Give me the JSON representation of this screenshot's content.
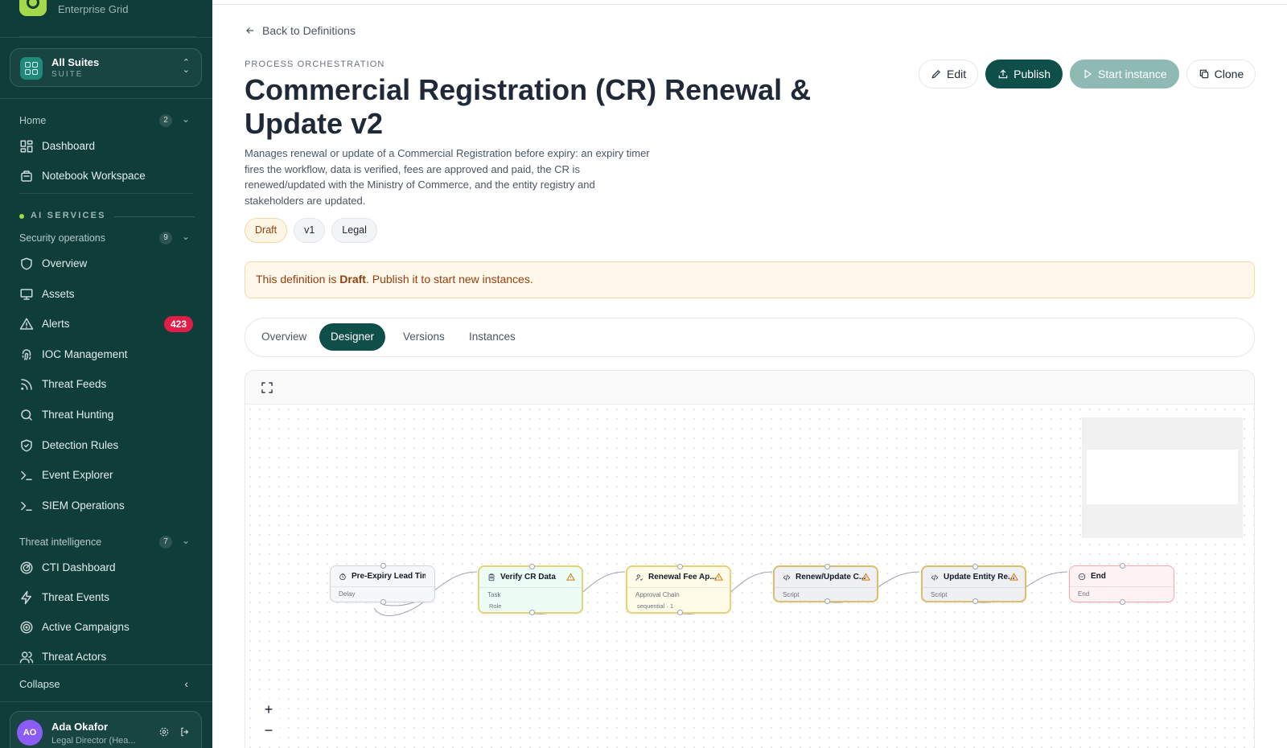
{
  "sidebar": {
    "brand_sub": "Enterprise Grid",
    "suite": {
      "title": "All Suites",
      "subtitle": "SUITE"
    },
    "groups": [
      {
        "label": "Home",
        "count": "2"
      },
      {
        "label": "Security operations",
        "count": "9"
      },
      {
        "label": "Threat intelligence",
        "count": "7"
      }
    ],
    "section_ai": "AI SERVICES",
    "home_items": [
      {
        "label": "Dashboard",
        "icon": "dashboard-icon"
      },
      {
        "label": "Notebook Workspace",
        "icon": "notebook-icon"
      }
    ],
    "secops_items": [
      {
        "label": "Overview",
        "icon": "shield-icon"
      },
      {
        "label": "Assets",
        "icon": "monitor-icon"
      },
      {
        "label": "Alerts",
        "icon": "alert-icon",
        "badge": "423"
      },
      {
        "label": "IOC Management",
        "icon": "fingerprint-icon"
      },
      {
        "label": "Threat Feeds",
        "icon": "rss-icon"
      },
      {
        "label": "Threat Hunting",
        "icon": "search-icon"
      },
      {
        "label": "Detection Rules",
        "icon": "shield-check-icon"
      },
      {
        "label": "Event Explorer",
        "icon": "terminal-icon"
      },
      {
        "label": "SIEM Operations",
        "icon": "terminal-icon"
      }
    ],
    "ti_items": [
      {
        "label": "CTI Dashboard",
        "icon": "radar-icon"
      },
      {
        "label": "Threat Events",
        "icon": "bolt-icon"
      },
      {
        "label": "Active Campaigns",
        "icon": "target-icon"
      },
      {
        "label": "Threat Actors",
        "icon": "users-icon"
      }
    ],
    "collapse_label": "Collapse",
    "user": {
      "initials": "AO",
      "name": "Ada Okafor",
      "role": "Legal Director (Hea..."
    }
  },
  "page": {
    "back_label": "Back to Definitions",
    "eyebrow": "PROCESS ORCHESTRATION",
    "title": "Commercial Registration (CR) Renewal & Update v2",
    "description": "Manages renewal or update of a Commercial Registration before expiry: an expiry timer fires the workflow, data is verified, fees are approved and paid, the CR is renewed/updated with the Ministry of Commerce, and the entity registry and stakeholders are updated.",
    "chips": [
      "Draft",
      "v1",
      "Legal"
    ],
    "actions": {
      "edit": "Edit",
      "publish": "Publish",
      "start": "Start instance",
      "clone": "Clone"
    },
    "alert": {
      "prefix": "This definition is ",
      "status": "Draft",
      "suffix": ". Publish it to start new instances."
    },
    "tabs": [
      "Overview",
      "Designer",
      "Versions",
      "Instances"
    ],
    "active_tab": "Designer"
  },
  "workflow": {
    "nodes": [
      {
        "title": "Pre-Expiry Lead Time",
        "type": "Delay",
        "icon": "clock-icon",
        "warn": false
      },
      {
        "title": "Verify CR Data",
        "type": "Task",
        "extra": "Role",
        "icon": "clipboard-icon",
        "warn": true
      },
      {
        "title": "Renewal Fee Ap...",
        "type": "Approval Chain",
        "extra": "sequential · 1",
        "icon": "user-check-icon",
        "warn": true
      },
      {
        "title": "Renew/Update C...",
        "type": "Script",
        "icon": "code-icon",
        "warn": true
      },
      {
        "title": "Update Entity Re...",
        "type": "Script",
        "icon": "code-icon",
        "warn": true
      },
      {
        "title": "End",
        "type": "End",
        "icon": "stop-circle-icon",
        "warn": false
      }
    ],
    "zoom_controls": [
      "+",
      "−"
    ]
  },
  "colors": {
    "sidebar_bg": "#0f3d3a",
    "primary": "#0f4f4a",
    "accent": "#a3d94a",
    "danger_badge": "#e11d48",
    "draft_bg": "#fff8ea"
  }
}
